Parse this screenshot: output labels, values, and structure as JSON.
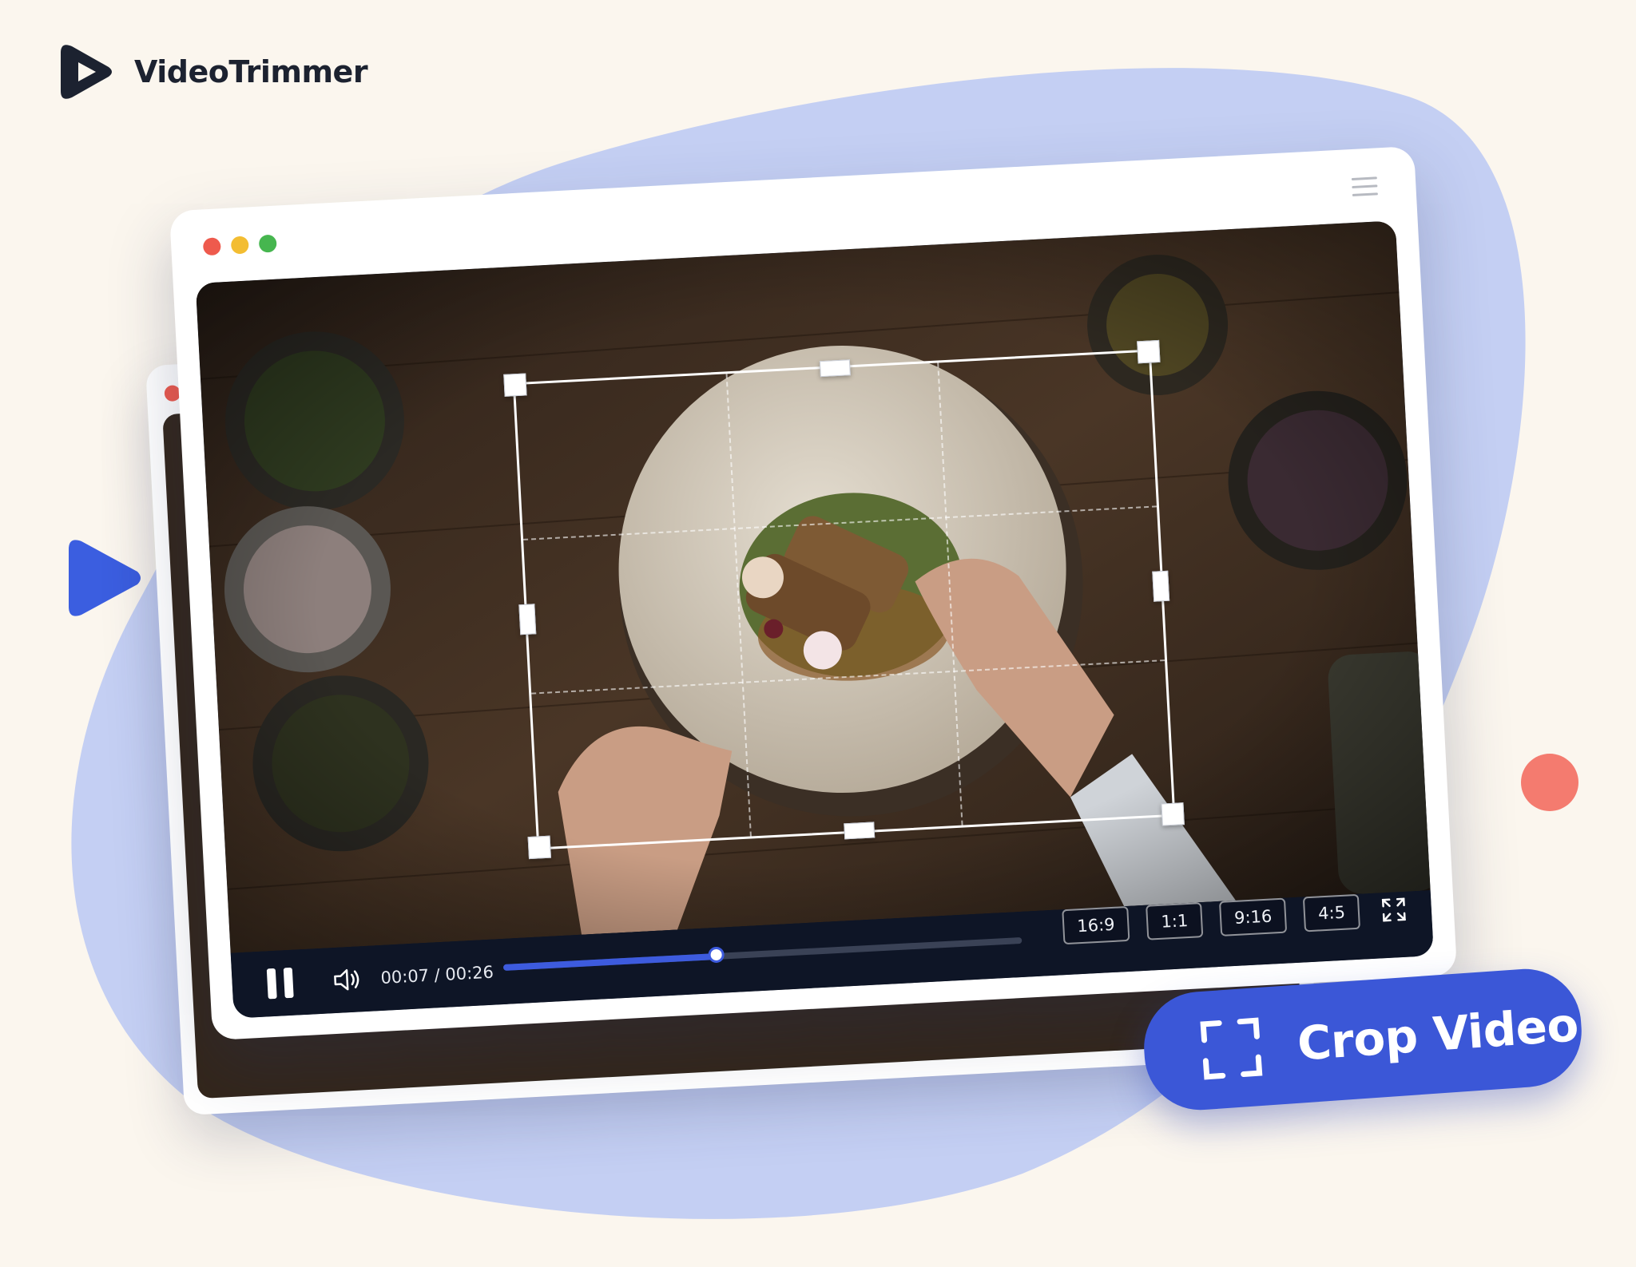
{
  "brand": {
    "name": "VideoTrimmer",
    "logo_icon": "play-logo-icon"
  },
  "colors": {
    "background": "#fbf6ee",
    "blob": "#c4cff3",
    "accent": "#3b57d7",
    "player_bar": "#0e1526",
    "decor_dot": "#f47b6f",
    "traffic_red": "#ee5a4d",
    "traffic_yellow": "#f3bd32",
    "traffic_green": "#46b64f"
  },
  "player": {
    "time_current": "00:07",
    "time_separator": " / ",
    "time_total": "00:26",
    "progress_fraction": 0.41,
    "aspect_ratios": [
      "16:9",
      "1:1",
      "9:16",
      "4:5"
    ],
    "icons": [
      "pause-icon",
      "volume-icon",
      "fullscreen-icon",
      "menu-icon"
    ]
  },
  "cta": {
    "label": "Crop Video",
    "icon": "crop-icon"
  }
}
